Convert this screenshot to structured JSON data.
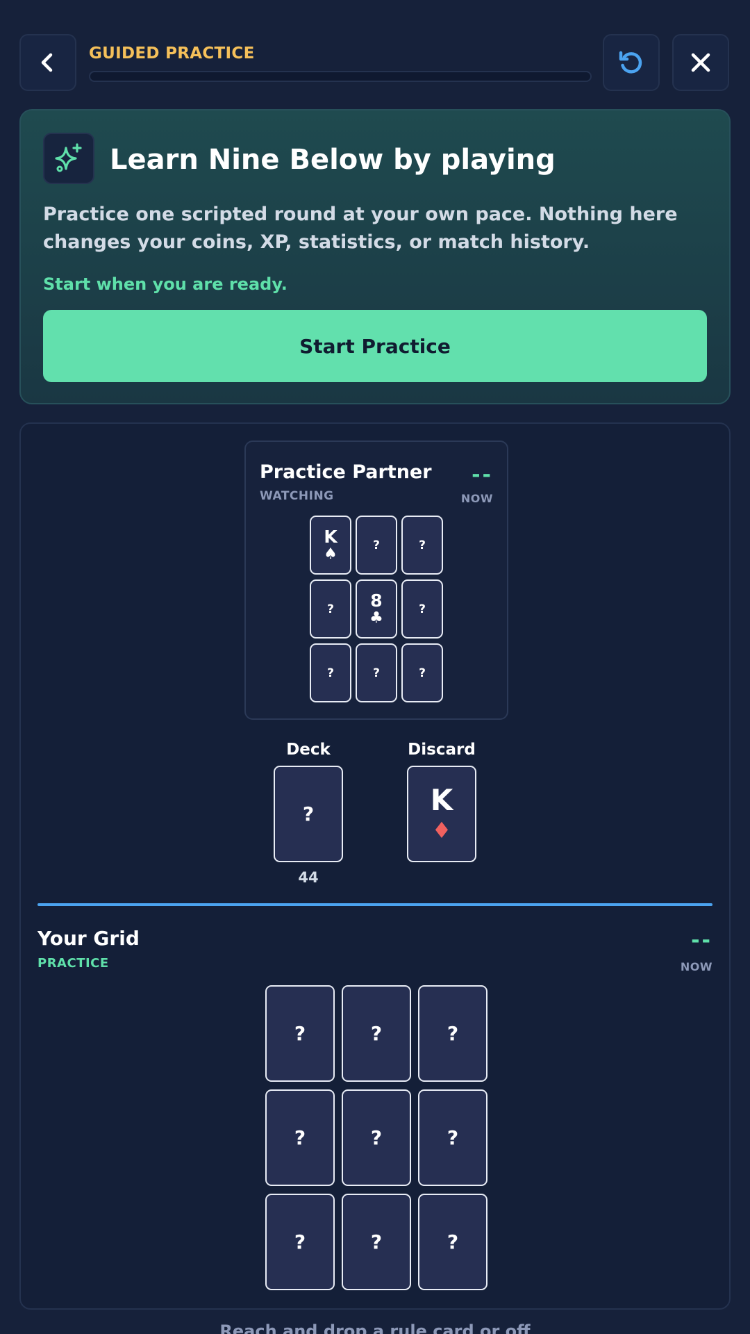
{
  "header": {
    "title": "GUIDED PRACTICE",
    "back_icon": "chevron-left-icon",
    "restart_icon": "restart-icon",
    "close_icon": "close-icon",
    "progress": 0,
    "accent_color": "#f5c05a"
  },
  "intro": {
    "icon": "sparkle-icon",
    "title": "Learn Nine Below by playing",
    "body": "Practice one scripted round at your own pace. Nothing here changes your coins, XP, statistics, or match history.",
    "ready_text": "Start when you are ready.",
    "start_button": "Start Practice",
    "button_color": "#62e0ad"
  },
  "partner": {
    "name": "Practice Partner",
    "status": "WATCHING",
    "score": "--",
    "time": "NOW",
    "cards": [
      {
        "rank": "K",
        "suit": "♠",
        "face_up": true
      },
      {
        "rank": "?",
        "suit": "",
        "face_up": false
      },
      {
        "rank": "?",
        "suit": "",
        "face_up": false
      },
      {
        "rank": "?",
        "suit": "",
        "face_up": false
      },
      {
        "rank": "8",
        "suit": "♣",
        "face_up": true
      },
      {
        "rank": "?",
        "suit": "",
        "face_up": false
      },
      {
        "rank": "?",
        "suit": "",
        "face_up": false
      },
      {
        "rank": "?",
        "suit": "",
        "face_up": false
      },
      {
        "rank": "?",
        "suit": "",
        "face_up": false
      }
    ]
  },
  "piles": {
    "deck_label": "Deck",
    "deck_card": "?",
    "deck_count": "44",
    "discard_label": "Discard",
    "discard_rank": "K",
    "discard_suit": "♦",
    "discard_suit_color": "#f0615f"
  },
  "player": {
    "title": "Your Grid",
    "status": "PRACTICE",
    "score": "--",
    "time": "NOW",
    "cards": [
      "?",
      "?",
      "?",
      "?",
      "?",
      "?",
      "?",
      "?",
      "?"
    ]
  },
  "footer": {
    "hint": "Reach and drop a rule card or off"
  }
}
